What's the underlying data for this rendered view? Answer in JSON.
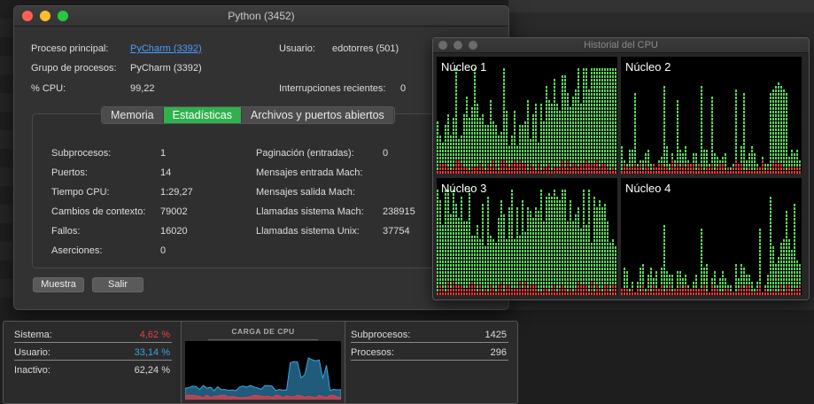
{
  "window": {
    "title": "Python (3452)",
    "parent_process_label": "Proceso principal:",
    "parent_process_value": "PyCharm (3392)",
    "process_group_label": "Grupo de procesos:",
    "process_group_value": "PyCharm (3392)",
    "cpu_label": "% CPU:",
    "cpu_value": "99,22",
    "user_label": "Usuario:",
    "user_value": "edotorres (501)",
    "interrupts_label": "Interrupciones recientes:",
    "interrupts_value": "0"
  },
  "tabs": [
    "Memoria",
    "Estadísticas",
    "Archivos y puertos abiertos"
  ],
  "active_tab": "Estadísticas",
  "stats_left": [
    {
      "label": "Subprocesos:",
      "value": "1"
    },
    {
      "label": "Puertos:",
      "value": "14"
    },
    {
      "label": "Tiempo CPU:",
      "value": "1:29,27"
    },
    {
      "label": "Cambios de contexto:",
      "value": "79002"
    },
    {
      "label": "Fallos:",
      "value": "16020"
    },
    {
      "label": "Aserciones:",
      "value": "0"
    }
  ],
  "stats_right": [
    {
      "label": "Paginación (entradas):",
      "value": "0"
    },
    {
      "label": "Mensajes entrada Mach:",
      "value": ""
    },
    {
      "label": "Mensajes salida Mach:",
      "value": ""
    },
    {
      "label": "Llamadas sistema Mach:",
      "value": "238915"
    },
    {
      "label": "Llamadas sistema Unix:",
      "value": "37754"
    }
  ],
  "buttons": {
    "sample": "Muestra",
    "quit": "Salir"
  },
  "history": {
    "title": "Historial del CPU",
    "cores": [
      "Núcleo 1",
      "Núcleo 2",
      "Núcleo 3",
      "Núcleo 4"
    ],
    "colors": {
      "user": "#5ed35e",
      "system": "#e03b3b"
    }
  },
  "cpu_load": {
    "title": "CARGA DE CPU",
    "system_label": "Sistema:",
    "system_value": "4,62 %",
    "user_label": "Usuario:",
    "user_value": "33,14 %",
    "idle_label": "Inactivo:",
    "idle_value": "62,24 %",
    "threads_label": "Subprocesos:",
    "threads_value": "1425",
    "processes_label": "Procesos:",
    "processes_value": "296",
    "colors": {
      "system": "#e0424b",
      "user": "#3aa6e0"
    }
  }
}
